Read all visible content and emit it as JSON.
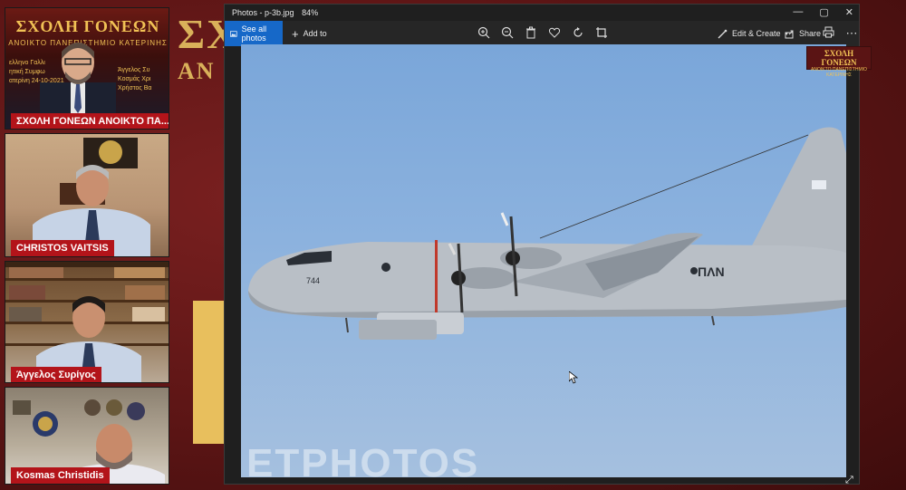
{
  "background": {
    "bg_letters_1": "ΣΧ",
    "bg_letters_2": "ΑΝ"
  },
  "participants": [
    {
      "name": "ΣΧΟΛΗ ΓΟΝΕΩΝ ΑΝΟΙΚΤΟ ΠΑ...",
      "banner_title": "ΣΧΟΛΗ ΓΟΝΕΩΝ",
      "banner_sub": "ΑΝΟΙΚΤΟ ΠΑΝΕΠΙΣΤΗΜΙΟ ΚΑΤΕΡΙΝΗΣ",
      "side_lines": [
        "Άγγελος Συ",
        "Κοσμάς Χρι",
        "Χρήστος Βα"
      ],
      "left_lines": [
        "ελληνο Γαλλι",
        "ητική Συμφω",
        "ατερίνη 24-10-2021"
      ]
    },
    {
      "name": "CHRISTOS VAITSIS"
    },
    {
      "name": "Άγγελος Συρίγος"
    },
    {
      "name": "Kosmas Christidis"
    }
  ],
  "window": {
    "title": "Photos - p-3b.jpg",
    "zoom": "84%",
    "see_all_photos": "See all photos",
    "add_to": "Add to",
    "edit_create": "Edit & Create",
    "share": "Share",
    "controls": [
      "—",
      "▢",
      "✕"
    ]
  },
  "photo": {
    "aircraft_number": "744",
    "tail_text": "ΠΛΝ",
    "watermark": "ETPHOTOS"
  },
  "logo": {
    "title": "ΣΧΟΛΗ ΓΟΝΕΩΝ",
    "subtitle": "ΑΝΟΙΚΤΟ ΠΑΝΕΠΙΣΤΗΜΙΟ ΚΑΤΕΡΙΝΗΣ"
  },
  "colors": {
    "accent_blue": "#1668c8",
    "name_badge": "#b3141a",
    "maroon": "#5a1414",
    "gold": "#f1c255"
  }
}
